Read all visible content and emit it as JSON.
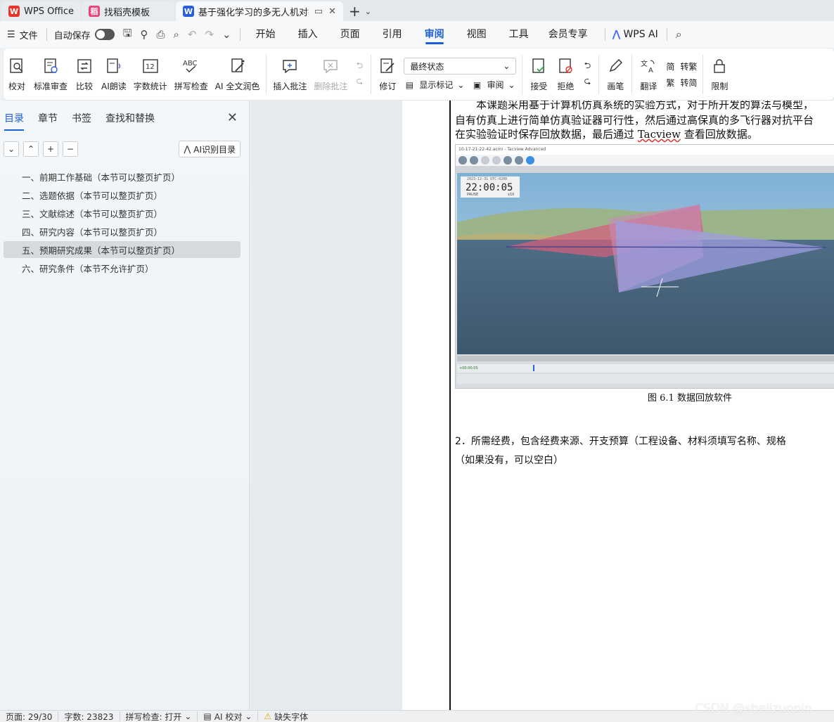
{
  "tabs": [
    {
      "label": "WPS Office",
      "icon": "wps-logo-icon",
      "color": "#e8352a"
    },
    {
      "label": "找稻壳模板",
      "icon": "docer-icon",
      "color": "#e8457a"
    },
    {
      "label": "基于强化学习的多无人机对抗",
      "icon": "word-doc-icon",
      "color": "#2b5fd9"
    }
  ],
  "menubar": {
    "file": "文件",
    "autosave": "自动保存",
    "tabs": [
      "开始",
      "插入",
      "页面",
      "引用",
      "审阅",
      "视图",
      "工具",
      "会员专享"
    ],
    "active_tab": "审阅",
    "wps_ai": "WPS AI"
  },
  "ribbon": {
    "buttons": [
      "校对",
      "标准审查",
      "比较",
      "AI朗读",
      "字数统计",
      "拼写检查",
      "AI 全文润色",
      "插入批注",
      "删除批注"
    ],
    "revise": "修订",
    "state_select": "最终状态",
    "show_marks": "显示标记",
    "review": "审阅",
    "accept": "接受",
    "reject": "拒绝",
    "pen": "画笔",
    "translate": "翻译",
    "trad": "转繁",
    "simp": "转简",
    "limit": "限制"
  },
  "nav": {
    "tabs": [
      "目录",
      "章节",
      "书签",
      "查找和替换"
    ],
    "ai_toc": "AI识别目录",
    "toc": [
      "一、前期工作基础（本节可以整页扩页）",
      "二、选题依据（本节可以整页扩页）",
      "三、文献综述（本节可以整页扩页）",
      "四、研究内容（本节可以整页扩页）",
      "五、预期研究成果（本节可以整页扩页）",
      "六、研究条件（本节不允许扩页）"
    ],
    "selected_index": 4
  },
  "document": {
    "line1": "本课题采用基于计算机仿真系统的实验方式，对于所开发的算法与模型，",
    "line2": "自有仿真上进行简单仿真验证器可行性，然后通过高保真的多飞行器对抗平台",
    "line3a": "在实验验证时保存回放数据，最后通过 ",
    "line3_word": "Tacview",
    "line3b": " 查看回放数据。",
    "figure": {
      "window_title": "10-17-21-22-42.acmi - Tacview Advanced",
      "date": "2023-12-31  UTC-0200",
      "time": "22:00:05",
      "pause": "PAUSE",
      "speed": "x10",
      "timeline": "+00:00:05"
    },
    "caption": "图 6.1 数据回放软件",
    "item2": "2．所需经费，包含经费来源、开支预算（工程设备、材料须填写名称、规格",
    "item2b": "（如果没有，可以空白）"
  },
  "status": {
    "page": "页面: 29/30",
    "words": "字数: 23823",
    "spell": "拼写检查: 打开",
    "ai_check": "AI 校对",
    "missing_font": "缺失字体"
  },
  "watermark": "CSDN @shejizuopin"
}
